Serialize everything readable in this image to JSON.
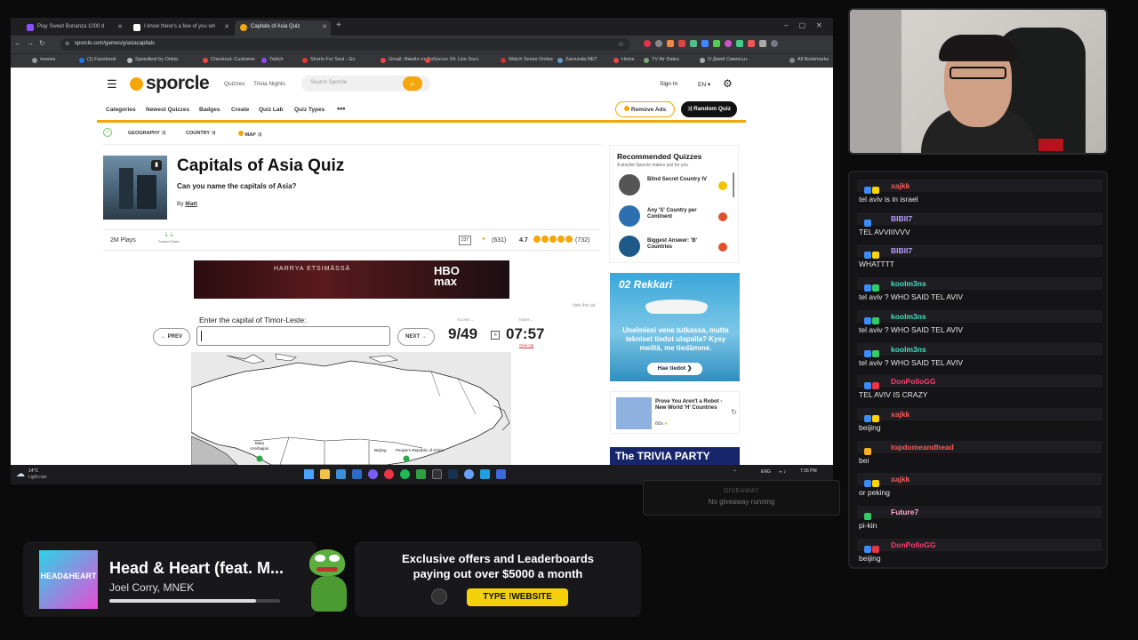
{
  "browser": {
    "tabs": [
      {
        "label": "Play Sweet Bonanza 1000 d",
        "color": "#8a4dff"
      },
      {
        "label": "I know there's a few of you wh",
        "color": "#ffffff"
      },
      {
        "label": "Capitals of Asia Quiz",
        "color": "#f5a60a"
      }
    ],
    "url": "sporcle.com/games/g/asiacapitals",
    "bookmarks": [
      {
        "label": "movies",
        "color": "#999"
      },
      {
        "label": "(1) Facebook",
        "color": "#1877f2"
      },
      {
        "label": "Speedtest by Ookla",
        "color": "#bbb"
      },
      {
        "label": "Checkout: Customer",
        "color": "#e44"
      },
      {
        "label": "Twitch",
        "color": "#9146ff"
      },
      {
        "label": "Shorts For Soul - Go",
        "color": "#e33"
      },
      {
        "label": "Gmail: Имейл от Go",
        "color": "#e44"
      },
      {
        "label": "Soccer 24: Live Socc",
        "color": "#e44"
      },
      {
        "label": "Watch Series Online",
        "color": "#c33"
      },
      {
        "label": "Zamunda.NET",
        "color": "#69c"
      },
      {
        "label": "Home",
        "color": "#e44"
      },
      {
        "label": "TV Air Dates",
        "color": "#7a7"
      },
      {
        "label": "О Джей Симпсън:",
        "color": "#aaa"
      },
      {
        "label": "All Bookmarks",
        "color": "#888"
      }
    ]
  },
  "sporcle": {
    "logo": "sporcle",
    "nav": [
      "Quizzes",
      "Trivia Nights"
    ],
    "search_placeholder": "Search Sporcle",
    "sign_in": "Sign In",
    "lang": "EN",
    "menu": [
      "Categories",
      "Newest Quizzes",
      "Badges",
      "Create",
      "Quiz Lab",
      "Quiz Types",
      "•••"
    ],
    "remove_ads": "Remove Ads",
    "random_quiz": "Random Quiz",
    "tags": [
      "GEOGRAPHY",
      "COUNTRY",
      "MAP"
    ],
    "quiz": {
      "title": "Capitals of Asia Quiz",
      "subtitle": "Can you name the capitals of Asia?",
      "by_label": "By",
      "author": "Matt",
      "plays": "2M Plays",
      "forced_order": "Forced Order",
      "comments": "237",
      "favorites": "(631)",
      "rating": "4.7",
      "rating_count": "(732)",
      "stars": 4.7,
      "prompt": "Enter the capital of Timor-Leste:",
      "prev": "PREV",
      "next": "NEXT",
      "score_label": "SCORE",
      "score": "9/49",
      "timer_label": "TIMER",
      "timer": "07:57",
      "give_up": "Give Up",
      "hide_ad": "hide this ad",
      "map_labels": [
        "Baku",
        "Azerbaijan",
        "Beijing",
        "People's Republic of China"
      ]
    },
    "ad_top": {
      "text": "HARRYA ETSIMÄSSÄ",
      "brand": "HBO max"
    },
    "recommended": {
      "title": "Recommended Quizzes",
      "subtitle": "A playlist Sporcle makes just for you",
      "items": [
        {
          "title": "Blind Secret Country IV",
          "badge_color": "#f5c400"
        },
        {
          "title": "Any 'S' Country per Continent",
          "badge_color": "#e0502a"
        },
        {
          "title": "Biggest Answer: 'B' Countries",
          "badge_color": "#e0502a"
        }
      ]
    },
    "ad_side": {
      "brand": "02 Rekkari",
      "text": "Unelmiesi vene tutkassa, mutta tekniset tiedot ulapalla? Kysy meiltä, me tiedämme.",
      "cta": "Hae tiedot ❯"
    },
    "robot": {
      "title": "Prove You Aren't a Robot - New World 'H' Countries",
      "time": "60s"
    },
    "ad_trivia": "The TRIVIA PARTY"
  },
  "taskbar": {
    "weather_temp": "14°C",
    "weather_desc": "Light rain",
    "lang": "ENG",
    "time": "7:36 PM"
  },
  "giveaway": {
    "title": "GIVEAWAY",
    "status": "No giveaway running"
  },
  "chat": [
    {
      "user": "xajkk",
      "color": "#ff5a5a",
      "badges": [
        "#3c8cff",
        "#ffd400"
      ],
      "text": "tel aviv is in israel"
    },
    {
      "user": "BIBII7",
      "color": "#b99bff",
      "badges": [
        "#3c8cff"
      ],
      "text": "TEL AVVIIIVVV"
    },
    {
      "user": "BIBII7",
      "color": "#b99bff",
      "badges": [
        "#3c8cff",
        "#ffd400"
      ],
      "text": "WHATTTT"
    },
    {
      "user": "koolm3ns",
      "color": "#3fe0c0",
      "badges": [
        "#3c8cff",
        "#33cc66"
      ],
      "text": "tel aviv ? WHO SAID TEL AVIV"
    },
    {
      "user": "koolm3ns",
      "color": "#3fe0c0",
      "badges": [
        "#3c8cff",
        "#33cc66"
      ],
      "text": "tel aviv ? WHO SAID TEL AVIV"
    },
    {
      "user": "koolm3ns",
      "color": "#3fe0c0",
      "badges": [
        "#3c8cff",
        "#33cc66"
      ],
      "text": "tel aviv ? WHO SAID TEL AVIV"
    },
    {
      "user": "DonPolloGG",
      "color": "#ff3a6e",
      "badges": [
        "#3c8cff",
        "#e34"
      ],
      "text": "TEL AVIV IS CRAZY"
    },
    {
      "user": "xajkk",
      "color": "#ff5a5a",
      "badges": [
        "#3c8cff",
        "#ffd400"
      ],
      "text": "beijing"
    },
    {
      "user": "topdomeandhead",
      "color": "#ff5a5a",
      "badges": [
        "#ffb020"
      ],
      "text": "bei"
    },
    {
      "user": "xajkk",
      "color": "#ff5a5a",
      "badges": [
        "#3c8cff",
        "#ffd400"
      ],
      "text": "or peking"
    },
    {
      "user": "Future7",
      "color": "#ffaad0",
      "badges": [
        "#33cc66"
      ],
      "text": "pi-kin"
    },
    {
      "user": "DonPolloGG",
      "color": "#ff3a6e",
      "badges": [
        "#3c8cff",
        "#e34"
      ],
      "text": "beijing"
    }
  ],
  "now_playing": {
    "title": "Head & Heart (feat. M...",
    "artist": "Joel Corry, MNEK",
    "art_text": "HEAD&HEART",
    "progress": 0.86
  },
  "promo": {
    "line1": "Exclusive offers and Leaderboards",
    "line2": "paying out over $5000 a month",
    "cta": "TYPE !WEBSITE"
  }
}
